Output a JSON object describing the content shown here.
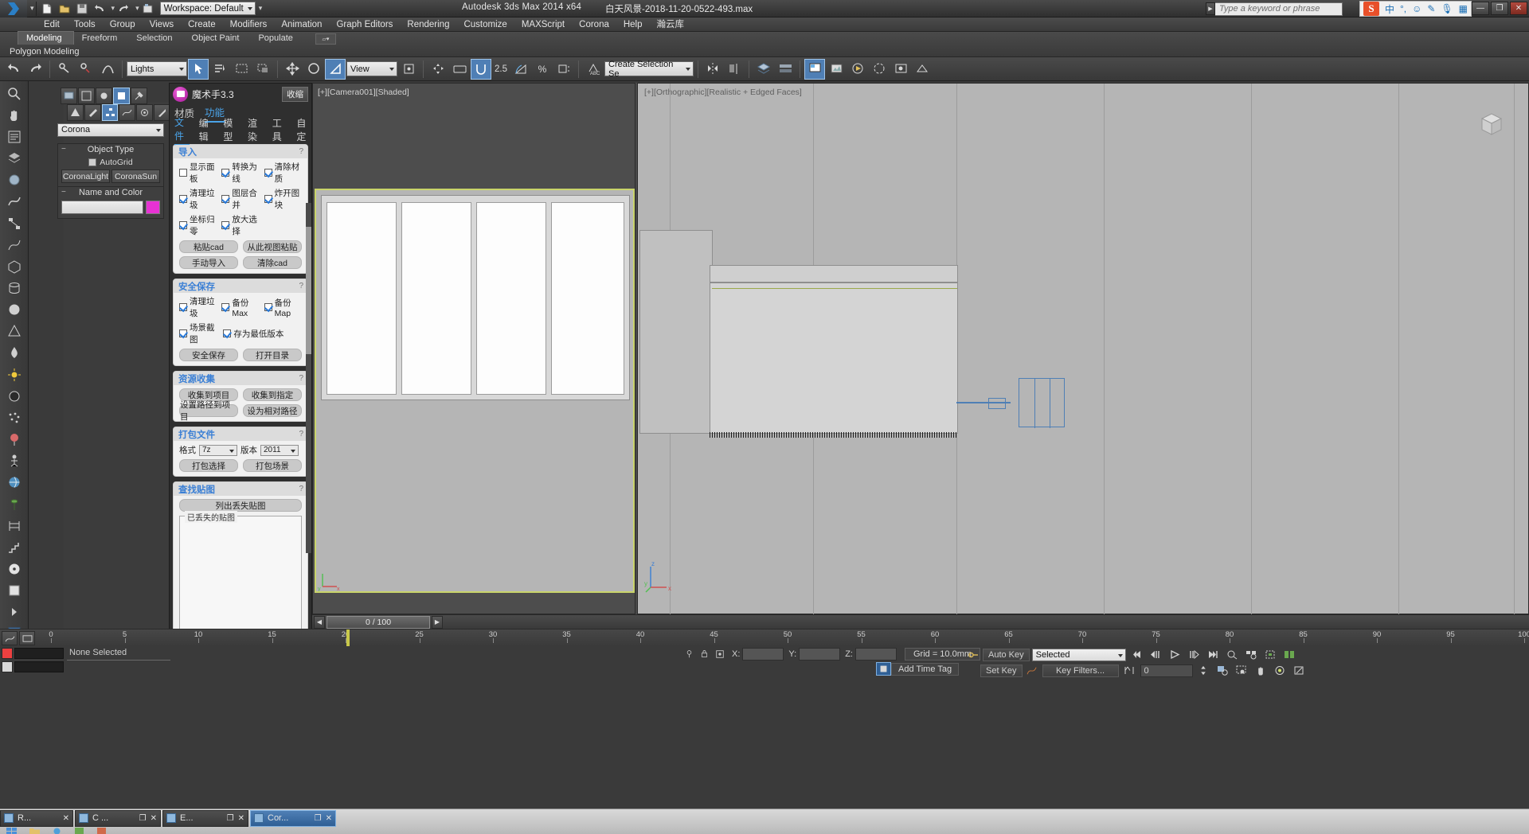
{
  "titlebar": {
    "app_title": "Autodesk 3ds Max  2014 x64",
    "document_title": "白天风景-2018-11-20-0522-493.max",
    "workspace": "Workspace: Default",
    "search_placeholder": "Type a keyword or phrase",
    "quick_access": [
      "new-icon",
      "open-icon",
      "save-icon",
      "undo-icon",
      "redo-icon",
      "setproject-icon"
    ],
    "ime": {
      "sogou": "S",
      "items": [
        "中",
        "°,",
        "☺",
        "✎",
        "🎤",
        "▦"
      ]
    },
    "window_buttons": [
      "—",
      "❐",
      "✕"
    ]
  },
  "menubar": {
    "items": [
      "Edit",
      "Tools",
      "Group",
      "Views",
      "Create",
      "Modifiers",
      "Animation",
      "Graph Editors",
      "Rendering",
      "Customize",
      "MAXScript",
      "Corona",
      "Help",
      "瀚云库"
    ]
  },
  "ribbon": {
    "tabs": [
      "Modeling",
      "Freeform",
      "Selection",
      "Object Paint",
      "Populate"
    ],
    "active_tab": "Modeling",
    "subtitle": "Polygon Modeling"
  },
  "main_toolbar": {
    "selection_filter": "Lights",
    "reference_coord": "View",
    "array_count": "2.5",
    "selection_set_placeholder": "Create Selection Se",
    "percent_label": "%",
    "abc_label": "ABC"
  },
  "command_panel": {
    "category": "Corona",
    "object_type": {
      "title": "Object Type",
      "autogrid_label": "AutoGrid",
      "buttons": [
        "CoronaLight",
        "CoronaSun"
      ]
    },
    "name_and_color": {
      "title": "Name and Color",
      "color_hex": "#e832d4"
    }
  },
  "plugin": {
    "title": "魔术手3.3",
    "minimize_label": "收缩",
    "tabs_primary": [
      "材质",
      "功能"
    ],
    "tabs_primary_active": "功能",
    "tabs_secondary": [
      "文件",
      "编辑",
      "模型",
      "渲染",
      "工具",
      "自定"
    ],
    "tabs_secondary_active": "文件",
    "groups": [
      {
        "id": "import",
        "title": "导入",
        "help": "?",
        "checkboxes": [
          {
            "label": "显示面板",
            "checked": false
          },
          {
            "label": "转换为线",
            "checked": true
          },
          {
            "label": "清除材质",
            "checked": true
          },
          {
            "label": "清理垃圾",
            "checked": true
          },
          {
            "label": "图层合并",
            "checked": true
          },
          {
            "label": "炸开图块",
            "checked": true
          },
          {
            "label": "坐标归零",
            "checked": true
          },
          {
            "label": "放大选择",
            "checked": true
          }
        ],
        "buttons": [
          "粘贴cad",
          "从此视图粘贴",
          "手动导入",
          "清除cad"
        ]
      },
      {
        "id": "safe_save",
        "title": "安全保存",
        "help": "?",
        "checkboxes": [
          {
            "label": "清理垃圾",
            "checked": true
          },
          {
            "label": "备份Max",
            "checked": true
          },
          {
            "label": "场景截图",
            "checked": true
          },
          {
            "label": "存为最低版本",
            "checked": true
          }
        ],
        "buttons": [
          "安全保存",
          "打开目录"
        ]
      },
      {
        "id": "resource_collect",
        "title": "资源收集",
        "help": "?",
        "buttons": [
          "收集到项目",
          "收集到指定",
          "设置路径到项目",
          "设为相对路径"
        ]
      },
      {
        "id": "pack_file",
        "title": "打包文件",
        "help": "?",
        "format_label": "格式",
        "format_value": "7z",
        "version_label": "版本",
        "version_value": "2011",
        "buttons": [
          "打包选择",
          "打包场景"
        ]
      },
      {
        "id": "find_map",
        "title": "查找贴图",
        "help": "?",
        "buttons": [
          "列出丢失贴图"
        ],
        "list_legend": "已丢失的贴图"
      }
    ]
  },
  "viewports": {
    "left": {
      "label": "[+][Camera001][Shaded]"
    },
    "right": {
      "label": "[+][Orthographic][Realistic + Edged Faces]"
    },
    "axis_left": {
      "x": "x",
      "y": "y"
    },
    "axis_right": {
      "x": "x",
      "y": "y",
      "z": "z"
    }
  },
  "timebar": {
    "current": "0 / 100",
    "prev_icon": "◀",
    "next_icon": "▶"
  },
  "trackbar": {
    "ticks": [
      0,
      5,
      10,
      15,
      20,
      25,
      30,
      35,
      40,
      45,
      50,
      55,
      60,
      65,
      70,
      75,
      80,
      85,
      90,
      95,
      100
    ]
  },
  "statusbar": {
    "selection": "None Selected",
    "coord_x_label": "X:",
    "coord_y_label": "Y:",
    "coord_z_label": "Z:",
    "coord_x": "",
    "coord_y": "",
    "coord_z": "",
    "grid": "Grid = 10.0mm",
    "add_time_tag": "Add Time Tag",
    "auto_key": "Auto Key",
    "set_key": "Set Key",
    "key_mode": "Selected",
    "key_filters": "Key Filters...",
    "frame_value": "0"
  },
  "taskbar": {
    "apps": [
      {
        "label": "R...",
        "active": false
      },
      {
        "label": "C ...",
        "active": false
      },
      {
        "label": "E...",
        "active": false
      },
      {
        "label": "Cor...",
        "active": true
      }
    ]
  },
  "colors": {
    "accent_blue": "#4aa3e8",
    "selection_blue": "#4f7fb5",
    "viewport_bg": "#b5b5b5",
    "highlight_yellow": "#c9d46a",
    "panel_dark": "#3a3a3a",
    "object_color": "#e832d4"
  }
}
